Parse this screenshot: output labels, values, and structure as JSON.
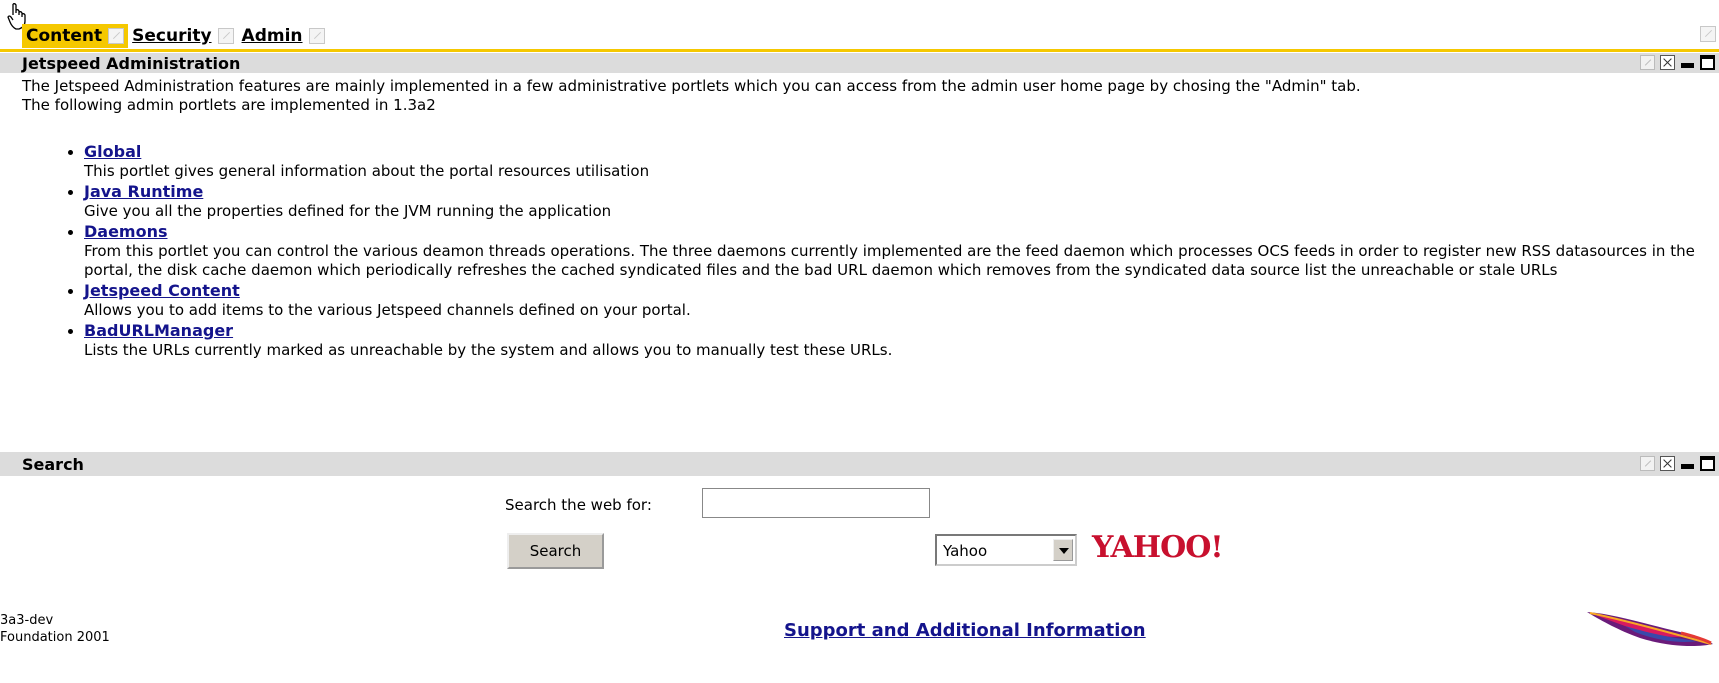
{
  "tabs": [
    {
      "label": "Content",
      "active": true
    },
    {
      "label": "Security",
      "active": false
    },
    {
      "label": "Admin",
      "active": false
    }
  ],
  "admin_portlet": {
    "title": "Jetspeed Administration",
    "intro_line1": "The Jetspeed Administration features are mainly implemented in a few administrative portlets which you can access from the admin user home page by chosing the \"Admin\" tab.",
    "intro_line2": "The following admin portlets are implemented in 1.3a2",
    "items": [
      {
        "link": "Global",
        "desc": "This portlet gives general information about the portal resources utilisation"
      },
      {
        "link": "Java Runtime",
        "desc": "Give you all the properties defined for the JVM running the application"
      },
      {
        "link": "Daemons",
        "desc": "From this portlet you can control the various deamon threads operations. The three daemons currently implemented are the feed daemon which processes OCS feeds in order to register new RSS datasources in the portal, the disk cache daemon which periodically refreshes the cached syndicated files and the bad URL daemon which removes from the syndicated data source list the unreachable or stale URLs"
      },
      {
        "link": "Jetspeed Content",
        "desc": "Allows you to add items to the various Jetspeed channels defined on your portal."
      },
      {
        "link": "BadURLManager",
        "desc": "Lists the URLs currently marked as unreachable by the system and allows you to manually test these URLs."
      }
    ]
  },
  "search_portlet": {
    "title": "Search",
    "label": "Search the web for:",
    "input_value": "",
    "button_label": "Search",
    "engine_selected": "Yahoo",
    "engine_logo": "YAHOO!"
  },
  "footer": {
    "left_line1": "3a3-dev",
    "left_line2": "Foundation 2001",
    "link": "Support and Additional Information"
  },
  "colors": {
    "accent": "#f5c800",
    "header_bg": "#dcdcdc",
    "link": "#14148c",
    "yahoo": "#c8102e"
  },
  "icons": [
    "hand-cursor-icon",
    "edit-icon",
    "close-icon",
    "minimize-icon",
    "maximize-icon",
    "apache-feather-icon"
  ]
}
